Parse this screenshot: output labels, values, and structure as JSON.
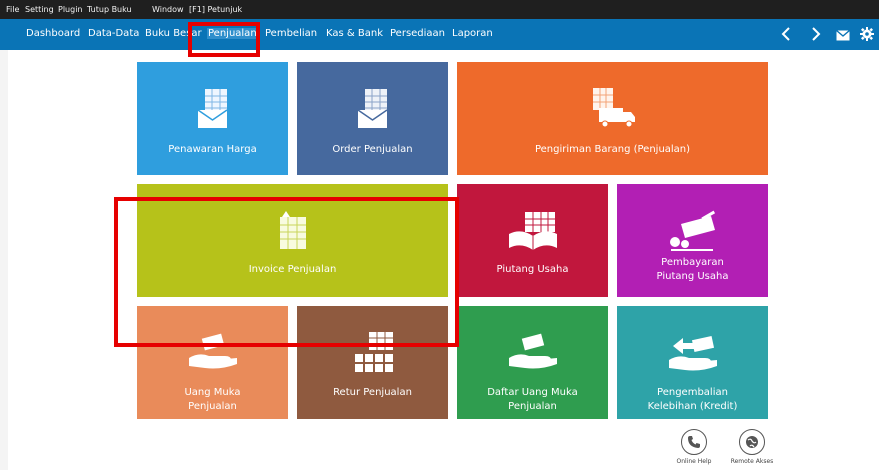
{
  "menubar": {
    "items": [
      "File",
      "Setting",
      "Plugin",
      "Tutup Buku",
      "Window",
      "[F1] Petunjuk"
    ]
  },
  "navbar": {
    "items": [
      "Dashboard",
      "Data-Data",
      "Buku Besar",
      "Penjualan",
      "Pembelian",
      "Kas & Bank",
      "Persediaan",
      "Laporan"
    ],
    "active": "Penjualan"
  },
  "tiles": {
    "penawaran_harga": {
      "label": "Penawaran Harga",
      "color": "#2f9ede"
    },
    "order_penjualan": {
      "label": "Order Penjualan",
      "color": "#46699e"
    },
    "pengiriman_barang": {
      "label": "Pengiriman Barang (Penjualan)",
      "color": "#ee6a2b"
    },
    "invoice_penjualan": {
      "label": "Invoice Penjualan",
      "color": "#b6c21a"
    },
    "piutang_usaha": {
      "label": "Piutang Usaha",
      "color": "#c1173d"
    },
    "pembayaran_piutang": {
      "line1": "Pembayaran",
      "line2": "Piutang Usaha",
      "color": "#b21fb4"
    },
    "uang_muka": {
      "line1": "Uang Muka",
      "line2": "Penjualan",
      "color": "#e98b5a"
    },
    "retur_penjualan": {
      "label": "Retur Penjualan",
      "color": "#8f5a3f"
    },
    "daftar_uang_muka": {
      "line1": "Daftar Uang Muka",
      "line2": "Penjualan",
      "color": "#2f9d4f"
    },
    "pengembalian": {
      "line1": "Pengembalian",
      "line2": "Kelebihan (Kredit)",
      "color": "#2ea3a8"
    }
  },
  "footer": {
    "online_help": "Online Help",
    "remote_akses": "Remote Akses"
  },
  "colors": {
    "navbar": "#0a74b6",
    "menubar": "#1f1f1f",
    "highlight": "#e60000"
  },
  "icons": [
    "chevron-left-icon",
    "chevron-right-icon",
    "mail-icon",
    "gear-icon",
    "phone-icon",
    "globe-icon"
  ]
}
